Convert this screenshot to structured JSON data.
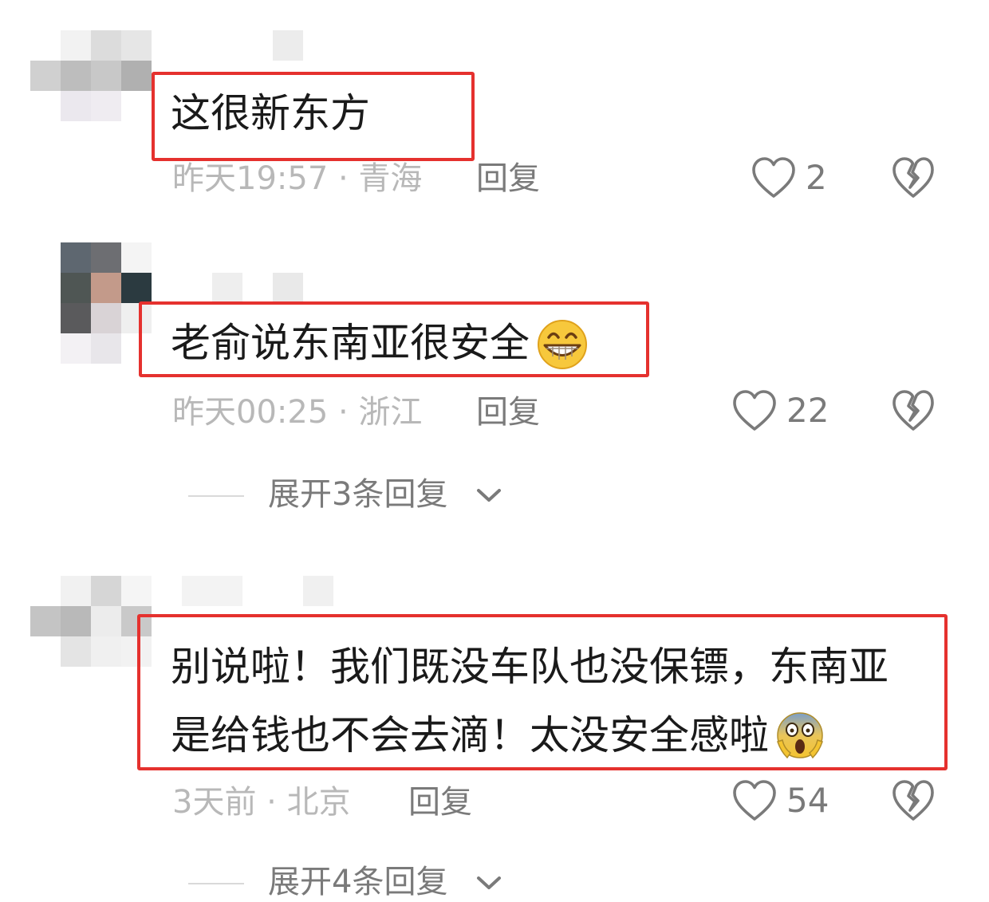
{
  "comments": [
    {
      "text": "这很新东方",
      "time": "昨天19:57",
      "sep": "·",
      "location": "青海",
      "reply_label": "回复",
      "likes": "2"
    },
    {
      "text": "老俞说东南亚很安全",
      "time": "昨天00:25",
      "sep": "·",
      "location": "浙江",
      "reply_label": "回复",
      "likes": "22",
      "expand_label": "展开3条回复"
    },
    {
      "text_line1": "别说啦！我们既没车队也没保镖，东南亚",
      "text_line2": "是给钱也不会去滴！太没安全感啦",
      "time": "3天前",
      "sep": "·",
      "location": "北京",
      "reply_label": "回复",
      "likes": "54",
      "expand_label": "展开4条回复"
    }
  ],
  "icons": {
    "like": "heart-outline-icon",
    "dislike": "broken-heart-icon",
    "expand": "chevron-down-icon",
    "emoji_grin": "grinning-face-emoji",
    "emoji_scream": "screaming-face-emoji"
  },
  "colors": {
    "highlight_box": "#e5312e",
    "meta_text": "#b8b8b8",
    "secondary_text": "#7a7a7a"
  }
}
